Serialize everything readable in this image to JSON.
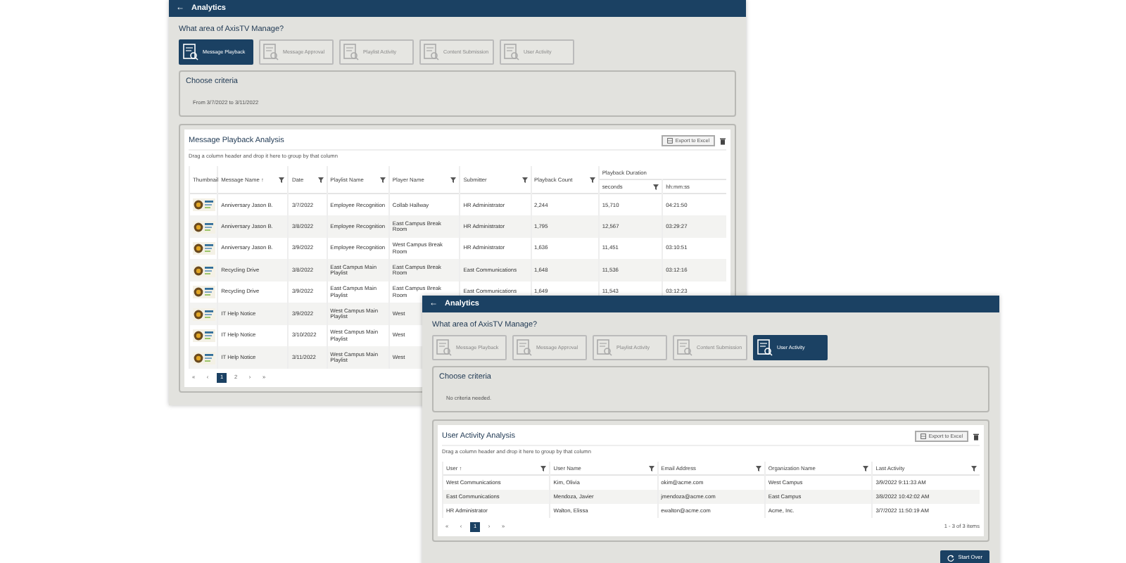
{
  "windows": [
    {
      "title": "Analytics",
      "back_icon": "←",
      "question": "What area of AxisTV Manage?",
      "tiles": [
        {
          "label": "Message Playback",
          "selected": true
        },
        {
          "label": "Message Approval",
          "selected": false
        },
        {
          "label": "Playlist Activity",
          "selected": false
        },
        {
          "label": "Content Submission",
          "selected": false
        },
        {
          "label": "User Activity",
          "selected": false
        }
      ],
      "criteria": {
        "title": "Choose criteria",
        "text": "From 3/7/2022 to 3/11/2022"
      },
      "report": {
        "title": "Message Playback Analysis",
        "export_button": "Export to Excel",
        "hint": "Drag a column header and drop it here to group by that column",
        "columns": [
          {
            "label": "Thumbnail",
            "kind": "picture"
          },
          {
            "label": "Message Name ↑",
            "kind": "text",
            "filter": true
          },
          {
            "label": "Date",
            "kind": "text",
            "filter": true
          },
          {
            "label": "Playlist Name",
            "kind": "text",
            "filter": true
          },
          {
            "label": "Player Name",
            "kind": "text",
            "filter": true
          },
          {
            "label": "Submitter",
            "kind": "text",
            "filter": true
          },
          {
            "label": "Playback Count",
            "kind": "text",
            "filter": true
          },
          {
            "label": "Playback Duration",
            "kind": "group",
            "colspan": 2,
            "columns": [
              {
                "label": "seconds",
                "filter": true
              },
              {
                "label": "hh:mm:ss",
                "filter": false
              }
            ]
          }
        ],
        "rows": [
          {
            "cells": [
              {
                "kind": "picture"
              },
              "Anniversary Jason B.",
              "3/7/2022",
              "Employee Recognition",
              "Collab Hallway",
              "HR Administrator",
              "2,244",
              "15,710",
              "04:21:50"
            ]
          },
          {
            "cells": [
              {
                "kind": "picture"
              },
              "Anniversary Jason B.",
              "3/8/2022",
              "Employee Recognition",
              "East Campus Break Room",
              "HR Administrator",
              "1,795",
              "12,567",
              "03:29:27"
            ]
          },
          {
            "cells": [
              {
                "kind": "picture"
              },
              "Anniversary Jason B.",
              "3/9/2022",
              "Employee Recognition",
              "West Campus Break Room",
              "HR Administrator",
              "1,636",
              "11,451",
              "03:10:51"
            ]
          },
          {
            "cells": [
              {
                "kind": "picture"
              },
              "Recycling Drive",
              "3/8/2022",
              "East Campus Main Playlist",
              "East Campus Break Room",
              "East Communications",
              "1,648",
              "11,536",
              "03:12:16"
            ]
          },
          {
            "cells": [
              {
                "kind": "picture"
              },
              "Recycling Drive",
              "3/9/2022",
              "East Campus Main Playlist",
              "East Campus Break Room",
              "East Communications",
              "1,649",
              "11,543",
              "03:12:23"
            ]
          },
          {
            "cells": [
              {
                "kind": "picture"
              },
              "IT Help Notice",
              "3/9/2022",
              "West Campus Main Playlist",
              "West"
            ]
          },
          {
            "cells": [
              {
                "kind": "picture"
              },
              "IT Help Notice",
              "3/10/2022",
              "West Campus Main Playlist",
              "West"
            ]
          },
          {
            "cells": [
              {
                "kind": "picture"
              },
              "IT Help Notice",
              "3/11/2022",
              "West Campus Main Playlist",
              "West"
            ]
          }
        ],
        "pager": {
          "pages": [
            {
              "label": "«",
              "selected": false
            },
            {
              "label": "‹",
              "selected": false
            },
            {
              "label": "1",
              "selected": true
            },
            {
              "label": "2",
              "selected": false
            },
            {
              "label": "›",
              "selected": false
            },
            {
              "label": "»",
              "selected": false
            }
          ]
        }
      }
    },
    {
      "title": "Analytics",
      "back_icon": "←",
      "question": "What area of AxisTV Manage?",
      "tiles": [
        {
          "label": "Message Playback",
          "selected": false
        },
        {
          "label": "Message Approval",
          "selected": false
        },
        {
          "label": "Playlist Activity",
          "selected": false
        },
        {
          "label": "Content Submission",
          "selected": false
        },
        {
          "label": "User Activity",
          "selected": true
        }
      ],
      "criteria": {
        "title": "Choose criteria",
        "text": "No criteria needed."
      },
      "report": {
        "title": "User Activity Analysis",
        "export_button": "Export to Excel",
        "hint": "Drag a column header and drop it here to group by that column",
        "columns": [
          {
            "label": "User ↑",
            "kind": "text",
            "filter": true
          },
          {
            "label": "User Name",
            "kind": "text",
            "filter": true
          },
          {
            "label": "Email Address",
            "kind": "text",
            "filter": true
          },
          {
            "label": "Organization Name",
            "kind": "text",
            "filter": true
          },
          {
            "label": "Last Activity",
            "kind": "text",
            "filter": true
          }
        ],
        "rows": [
          {
            "cells": [
              "West Communications",
              "Kim, Olivia",
              "okim@acme.com",
              "West Campus",
              "3/9/2022  9:11:33 AM"
            ]
          },
          {
            "cells": [
              "East Communications",
              "Mendoza, Javier",
              "jmendoza@acme.com",
              "East Campus",
              "3/8/2022  10:42:02 AM"
            ]
          },
          {
            "cells": [
              "HR Administrator",
              "Walton, Elissa",
              "ewalton@acme.com",
              "Acme, Inc.",
              "3/7/2022  11:50:19 AM"
            ]
          }
        ],
        "pager": {
          "pages": [
            {
              "label": "«",
              "selected": false
            },
            {
              "label": "‹",
              "selected": false
            },
            {
              "label": "1",
              "selected": true
            },
            {
              "label": "›",
              "selected": false
            },
            {
              "label": "»",
              "selected": false
            }
          ],
          "summary": "1 - 3 of 3 items"
        }
      },
      "start_over_button": "Start Over"
    }
  ]
}
